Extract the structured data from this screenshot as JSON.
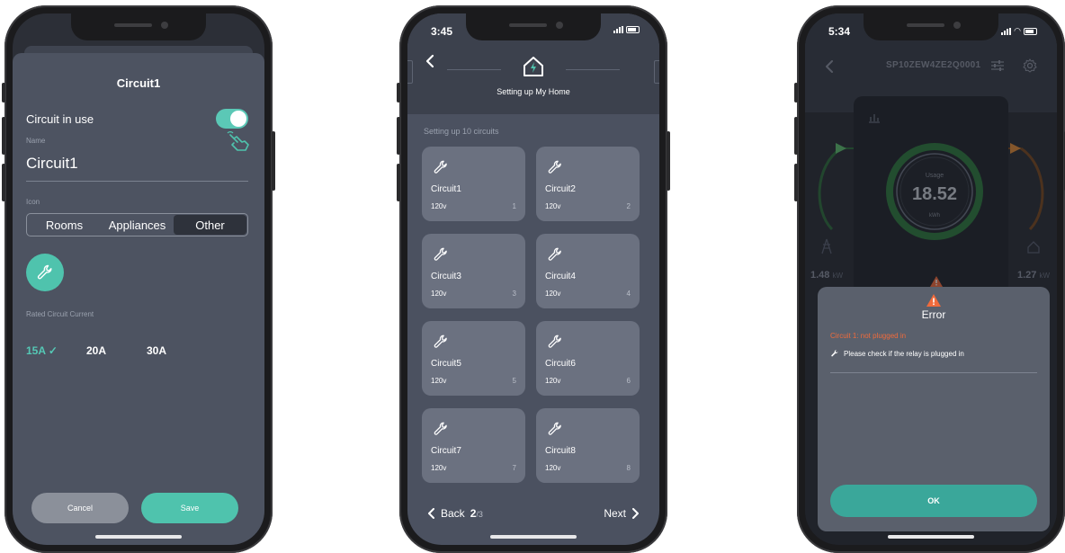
{
  "phone1": {
    "title": "Circuit1",
    "circuit_in_use_label": "Circuit in use",
    "circuit_in_use": true,
    "name_label": "Name",
    "name_value": "Circuit1",
    "icon_label": "Icon",
    "icon_tabs": [
      "Rooms",
      "Appliances",
      "Other"
    ],
    "icon_tab_selected": "Other",
    "selected_icon": "wrench-icon",
    "rated_current_label": "Rated Circuit Current",
    "currents": [
      "15A",
      "20A",
      "30A"
    ],
    "current_selected": "15A",
    "cancel_label": "Cancel",
    "save_label": "Save",
    "accent_color": "#4fc3ad"
  },
  "phone2": {
    "time": "3:45",
    "header_title": "Setting up My Home",
    "subtitle": "Setting up 10 circuits",
    "circuits": [
      {
        "name": "Circuit1",
        "voltage": "120v",
        "num": "1"
      },
      {
        "name": "Circuit2",
        "voltage": "120v",
        "num": "2"
      },
      {
        "name": "Circuit3",
        "voltage": "120v",
        "num": "3"
      },
      {
        "name": "Circuit4",
        "voltage": "120v",
        "num": "4"
      },
      {
        "name": "Circuit5",
        "voltage": "120v",
        "num": "5"
      },
      {
        "name": "Circuit6",
        "voltage": "120v",
        "num": "6"
      },
      {
        "name": "Circuit7",
        "voltage": "120v",
        "num": "7"
      },
      {
        "name": "Circuit8",
        "voltage": "120v",
        "num": "8"
      }
    ],
    "back_label": "Back",
    "page_current": "2",
    "page_total": "/3",
    "next_label": "Next"
  },
  "phone3": {
    "time": "5:34",
    "serial": "SP10ZEW4ZE2Q0001",
    "usage_label": "Usage",
    "usage_value": "18.52",
    "usage_unit": "kWh",
    "left_value": "1.48",
    "left_unit": "kW",
    "right_value": "1.27",
    "right_unit": "kW",
    "error_title": "Error",
    "error_message": "Circuit 1: not plugged in",
    "help_message": "Please check if the relay is  plugged in",
    "ok_label": "OK",
    "error_color": "#f06b3c"
  }
}
